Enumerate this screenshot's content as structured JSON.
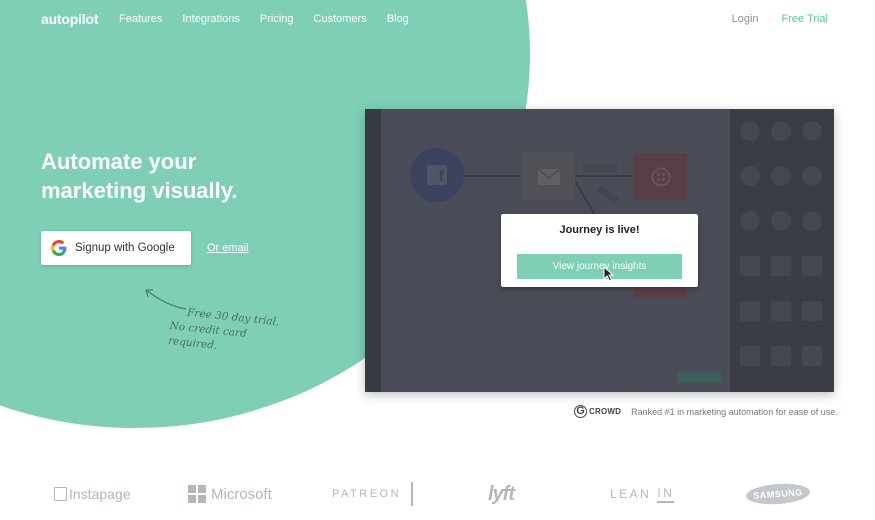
{
  "nav": {
    "logo": "autopilot",
    "links": [
      "Features",
      "Integrations",
      "Pricing",
      "Customers",
      "Blog"
    ],
    "login": "Login",
    "free_trial": "Free Trial"
  },
  "hero": {
    "headline": "Automate your marketing visually.",
    "google_button": "Signup with Google",
    "or_email": "Or email",
    "note_line1": "Free 30 day trial.",
    "note_line2": "No credit card required."
  },
  "app_preview": {
    "modal_title": "Journey is live!",
    "modal_button": "View journey insights",
    "icons": [
      "facebook-icon",
      "mail-icon",
      "twilio-icon"
    ]
  },
  "badge": {
    "logo_g": "G",
    "logo_crowd": "CROWD",
    "text": "Ranked #1 in marketing automation for ease of use."
  },
  "logos": {
    "instapage": "Instapage",
    "microsoft": "Microsoft",
    "patreon": "PATREON",
    "lyft": "lyft",
    "lean": "LEAN",
    "lean_in": "IN",
    "samsung": "SAMSUNG"
  },
  "colors": {
    "accent": "#7ecfb6",
    "trial": "#5fc1a4",
    "app_bg": "#4a4d57"
  }
}
